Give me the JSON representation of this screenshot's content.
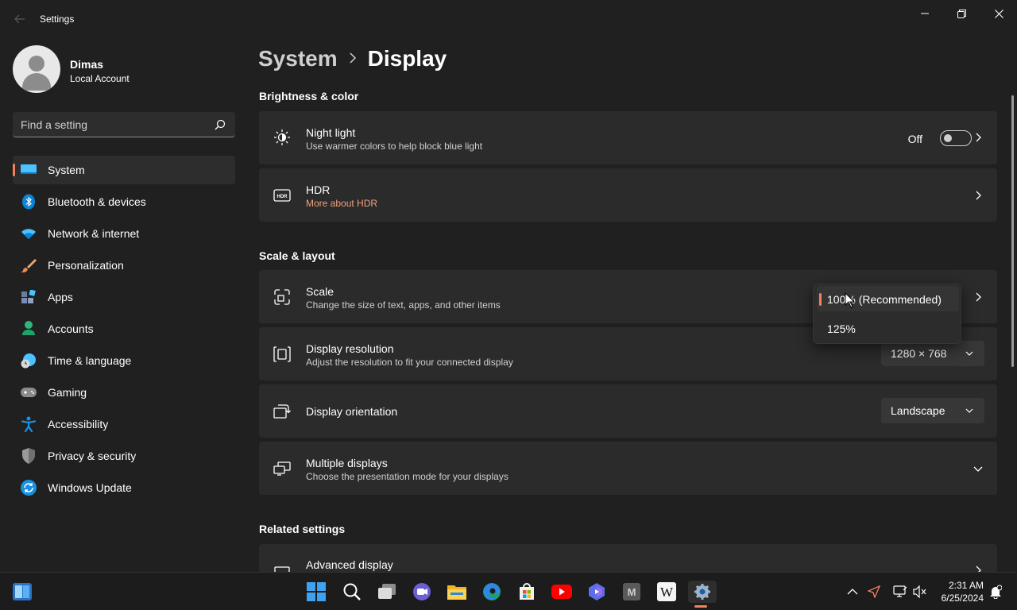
{
  "window": {
    "title": "Settings"
  },
  "profile": {
    "name": "Dimas",
    "account_type": "Local Account"
  },
  "search": {
    "placeholder": "Find a setting"
  },
  "sidebar": {
    "items": [
      {
        "label": "System",
        "icon": "system-icon",
        "active": true
      },
      {
        "label": "Bluetooth & devices",
        "icon": "bluetooth-icon"
      },
      {
        "label": "Network & internet",
        "icon": "wifi-icon"
      },
      {
        "label": "Personalization",
        "icon": "brush-icon"
      },
      {
        "label": "Apps",
        "icon": "apps-icon"
      },
      {
        "label": "Accounts",
        "icon": "accounts-icon"
      },
      {
        "label": "Time & language",
        "icon": "clock-globe-icon"
      },
      {
        "label": "Gaming",
        "icon": "gamepad-icon"
      },
      {
        "label": "Accessibility",
        "icon": "accessibility-icon"
      },
      {
        "label": "Privacy & security",
        "icon": "shield-icon"
      },
      {
        "label": "Windows Update",
        "icon": "update-icon"
      }
    ]
  },
  "breadcrumb": {
    "parent": "System",
    "current": "Display"
  },
  "sections": {
    "brightness": "Brightness & color",
    "scale_layout": "Scale & layout",
    "related": "Related settings"
  },
  "cards": {
    "night_light": {
      "title": "Night light",
      "desc": "Use warmer colors to help block blue light",
      "toggle_label": "Off",
      "toggle_on": false
    },
    "hdr": {
      "title": "HDR",
      "link": "More about HDR"
    },
    "scale": {
      "title": "Scale",
      "desc": "Change the size of text, apps, and other items"
    },
    "resolution": {
      "title": "Display resolution",
      "desc": "Adjust the resolution to fit your connected display",
      "value": "1280 × 768"
    },
    "orientation": {
      "title": "Display orientation",
      "value": "Landscape"
    },
    "multiple": {
      "title": "Multiple displays",
      "desc": "Choose the presentation mode for your displays"
    },
    "advanced": {
      "title": "Advanced display"
    }
  },
  "scale_dropdown": {
    "options": [
      "100% (Recommended)",
      "125%"
    ],
    "selected": "100% (Recommended)"
  },
  "taskbar": {
    "apps": [
      "start-icon",
      "search-icon",
      "task-view-icon",
      "teams-icon",
      "file-explorer-icon",
      "edge-icon",
      "store-icon",
      "youtube-icon",
      "clipchamp-icon",
      "m-app-icon",
      "wikipedia-icon",
      "settings-icon"
    ],
    "wikipedia_glyph": "W",
    "m_glyph": "M",
    "time": "2:31 AM",
    "date": "6/25/2024"
  },
  "colors": {
    "accent": "#f4805f",
    "background": "#202020",
    "card": "#2b2b2b"
  }
}
